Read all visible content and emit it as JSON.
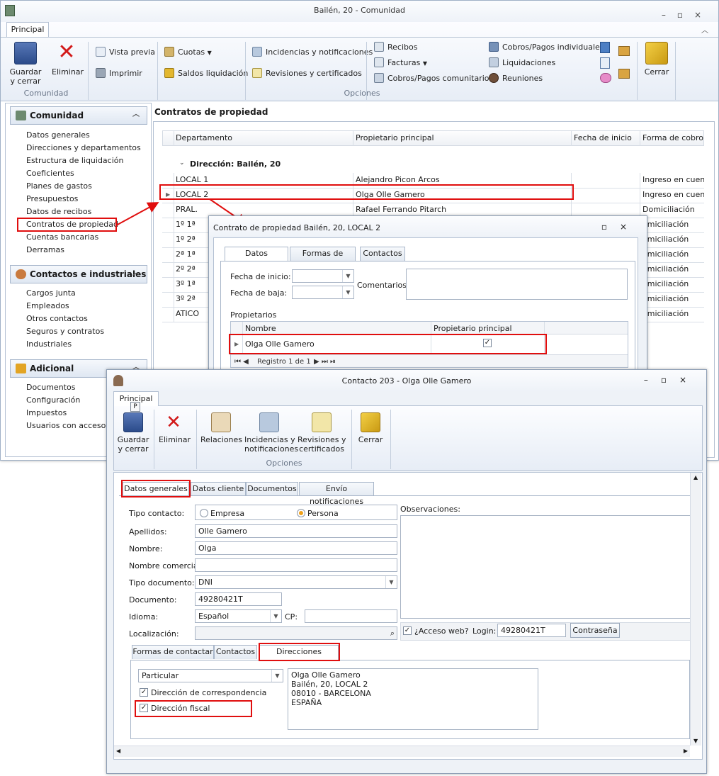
{
  "main_window": {
    "title": "Bailén, 20 - Comunidad",
    "ribbon_tab": "Principal",
    "buttons": {
      "save": "Guardar\ny cerrar",
      "delete": "Eliminar",
      "preview": "Vista previa",
      "print": "Imprimir",
      "quotas": "Cuotas",
      "liquidation_balances": "Saldos liquidación",
      "incidents": "Incidencias y notificaciones",
      "reviews": "Revisiones y certificados",
      "receipts": "Recibos",
      "invoices": "Facturas",
      "community_payments": "Cobros/Pagos comunitarios",
      "individual_payments": "Cobros/Pagos individuales",
      "liquidations": "Liquidaciones",
      "meetings": "Reuniones",
      "close": "Cerrar"
    },
    "group_labels": {
      "community": "Comunidad",
      "options": "Opciones"
    }
  },
  "sidebar": {
    "sections": [
      {
        "title": "Comunidad",
        "items": [
          "Datos generales",
          "Direcciones y departamentos",
          "Estructura de liquidación",
          "Coeficientes",
          "Planes de gastos",
          "Presupuestos",
          "Datos de recibos",
          "Contratos de propiedad",
          "Cuentas bancarias",
          "Derramas"
        ]
      },
      {
        "title": "Contactos e industriales",
        "items": [
          "Cargos junta",
          "Empleados",
          "Otros contactos",
          "Seguros y contratos",
          "Industriales"
        ]
      },
      {
        "title": "Adicional",
        "items": [
          "Documentos",
          "Configuración",
          "Impuestos",
          "Usuarios con acceso"
        ]
      }
    ]
  },
  "contracts_panel": {
    "title": "Contratos de propiedad",
    "columns": [
      "Departamento",
      "Propietario principal",
      "Fecha de inicio",
      "Forma de cobro"
    ],
    "group_label": "Dirección: Bailén, 20",
    "rows": [
      [
        "LOCAL 1",
        "Alejandro Picon Arcos",
        "",
        "Ingreso en cuenta"
      ],
      [
        "LOCAL 2",
        "Olga Olle Gamero",
        "",
        "Ingreso en cuenta"
      ],
      [
        "PRAL.",
        "Rafael Ferrando Pitarch",
        "",
        "Domiciliación"
      ],
      [
        "1º 1ª",
        "",
        "",
        "omiciliación"
      ],
      [
        "1º 2ª",
        "",
        "",
        "omiciliación"
      ],
      [
        "2ª 1ª",
        "",
        "",
        "omiciliación"
      ],
      [
        "2º 2ª",
        "",
        "",
        "omiciliación"
      ],
      [
        "3º 1ª",
        "",
        "",
        "omiciliación"
      ],
      [
        "3º 2ª",
        "",
        "",
        "omiciliación"
      ],
      [
        "ATICO",
        "",
        "",
        "omiciliación"
      ]
    ]
  },
  "contract_dialog": {
    "title": "Contrato de propiedad Bailén, 20, LOCAL 2",
    "tabs": [
      "Datos generales",
      "Formas de cobro",
      "Contactos"
    ],
    "start_label": "Fecha de inicio:",
    "end_label": "Fecha de baja:",
    "comments_label": "Comentarios:",
    "owners_label": "Propietarios",
    "owners_columns": [
      "Nombre",
      "Propietario principal"
    ],
    "owner_name": "Olga Olle Gamero",
    "pager": "Registro 1 de 1"
  },
  "contact_window": {
    "title": "Contacto 203 - Olga Olle Gamero",
    "ribbon_tab": "Principal",
    "keytip": "P",
    "buttons": {
      "save": "Guardar\ny cerrar",
      "delete": "Eliminar",
      "relations": "Relaciones",
      "incidents": "Incidencias y\nnotificaciones",
      "reviews": "Revisiones y\ncertificados",
      "close": "Cerrar"
    },
    "group_label": "Opciones",
    "tabs": [
      "Datos generales",
      "Datos cliente",
      "Documentos",
      "Envío notificaciones"
    ],
    "form": {
      "contact_type_label": "Tipo contacto:",
      "company": "Empresa",
      "person": "Persona",
      "surname_label": "Apellidos:",
      "surname": "Olle Gamero",
      "name_label": "Nombre:",
      "name": "Olga",
      "trade_name_label": "Nombre comercial:",
      "doc_type_label": "Tipo documento:",
      "doc_type": "DNI",
      "document_label": "Documento:",
      "document": "49280421T",
      "language_label": "Idioma:",
      "language": "Español",
      "cp_label": "CP:",
      "location_label": "Localización:",
      "observations_label": "Observaciones:",
      "web_access_label": "¿Acceso web?",
      "login_label": "Login:",
      "login": "49280421T",
      "password_button": "Contraseña"
    },
    "sub_tabs": [
      "Formas de contactar",
      "Contactos",
      "Direcciones postales"
    ],
    "address": {
      "type": "Particular",
      "mail_address": "Dirección de correspondencia",
      "fiscal_address": "Dirección fiscal",
      "lines": [
        "Olga Olle Gamero",
        "Bailén, 20, LOCAL 2",
        "08010 - BARCELONA",
        "ESPAÑA"
      ]
    }
  }
}
